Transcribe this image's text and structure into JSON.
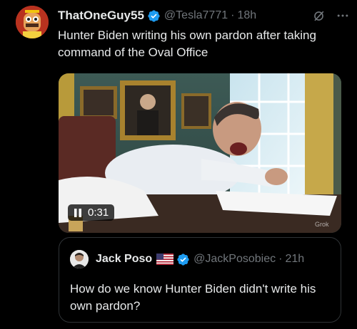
{
  "tweet": {
    "author_name": "ThatOneGuy55",
    "author_handle": "@Tesla7771",
    "separator": "·",
    "time": "18h",
    "text": "Hunter Biden writing his own pardon after taking command of the Oval Office"
  },
  "media": {
    "duration": "0:31",
    "watermark": "Grok"
  },
  "quoted": {
    "author_name": "Jack Poso",
    "author_handle": "@JackPosobiec",
    "separator": "·",
    "time": "21h",
    "text": "How do we know Hunter Biden didn't write his own pardon?"
  },
  "colors": {
    "background": "#000000",
    "text": "#e7e9ea",
    "muted": "#71767b",
    "verified": "#1d9bf0",
    "border": "#2f3336"
  },
  "icons": [
    "verified-badge-icon",
    "grok-icon",
    "more-icon",
    "pause-icon",
    "us-flag-icon"
  ]
}
